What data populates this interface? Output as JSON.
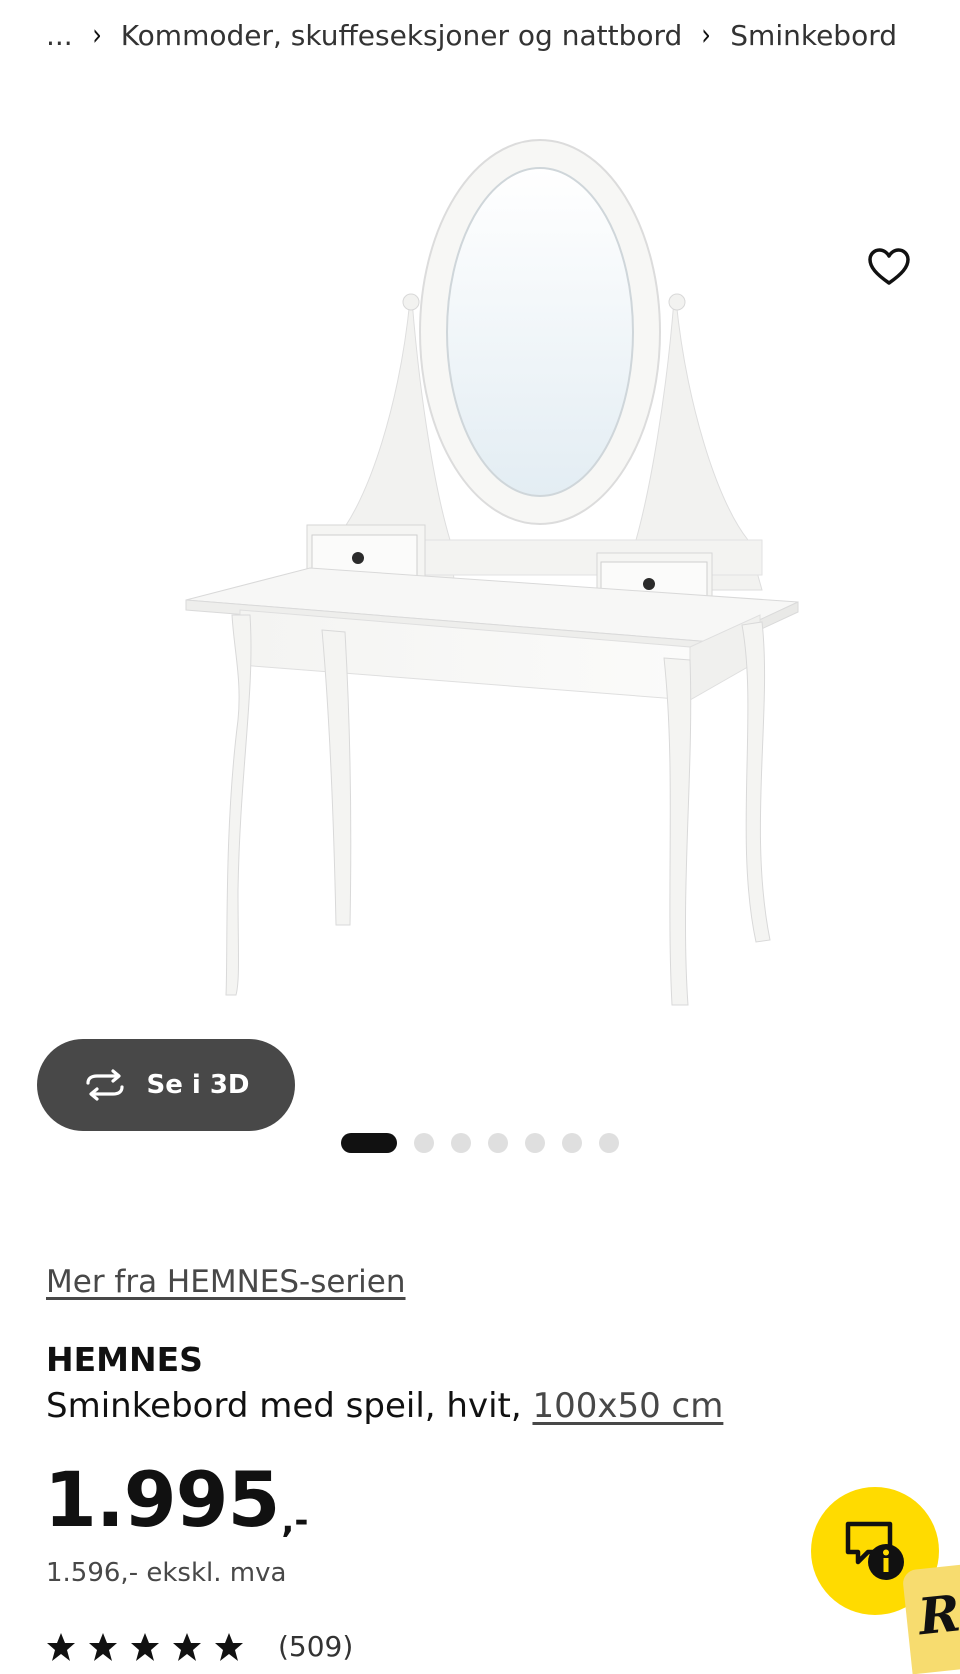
{
  "breadcrumb": {
    "ellipsis": "...",
    "items": [
      "Kommoder, skuffeseksjoner og nattbord",
      "Sminkebord"
    ]
  },
  "gallery": {
    "view_3d_label": "Se i 3D",
    "slide_count": 7,
    "active_slide": 1
  },
  "product": {
    "series_link": "Mer fra HEMNES-serien",
    "name": "HEMNES",
    "description": "Sminkebord med speil, hvit, ",
    "size": "100x50 cm",
    "price": "1.995",
    "price_suffix": ",-",
    "price_ex_vat": "1.596,- ekskl. mva",
    "rating_stars": 5,
    "review_count": "(509)"
  },
  "badge": {
    "letter": "R"
  },
  "colors": {
    "accent_yellow": "#ffdb00",
    "button_dark": "#484848",
    "text": "#111111"
  },
  "icons": [
    "chevron-right-icon",
    "heart-icon",
    "rotate-3d-icon",
    "chat-info-icon",
    "star-icon"
  ]
}
